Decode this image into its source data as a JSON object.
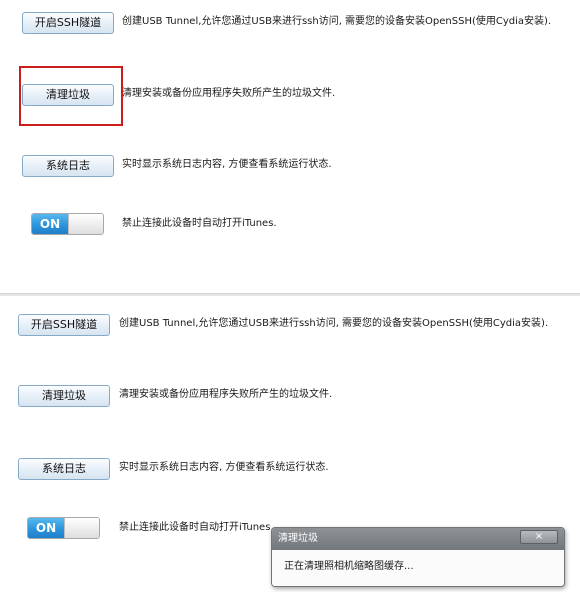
{
  "settings": {
    "ssh_button_label": "开启SSH隧道",
    "ssh_description": "创建USB Tunnel,允许您通过USB来进行ssh访问, 需要您的设备安装OpenSSH(使用Cydia安装).",
    "clean_button_label": "清理垃圾",
    "clean_description": "清理安装或备份应用程序失败所产生的垃圾文件.",
    "syslog_button_label": "系统日志",
    "syslog_description": "实时显示系统日志内容, 方便查看系统运行状态.",
    "itunes_toggle_state": "ON",
    "itunes_description": "禁止连接此设备时自动打开iTunes."
  },
  "dialog": {
    "title": "清理垃圾",
    "close_symbol": "×",
    "message": "正在清理照相机缩略图缓存..."
  },
  "colors": {
    "toggle_on": "#2b95dc",
    "highlight": "#cc1d1d",
    "dialog_titlebar": "#7d8185",
    "button_border": "#87a9c8"
  }
}
